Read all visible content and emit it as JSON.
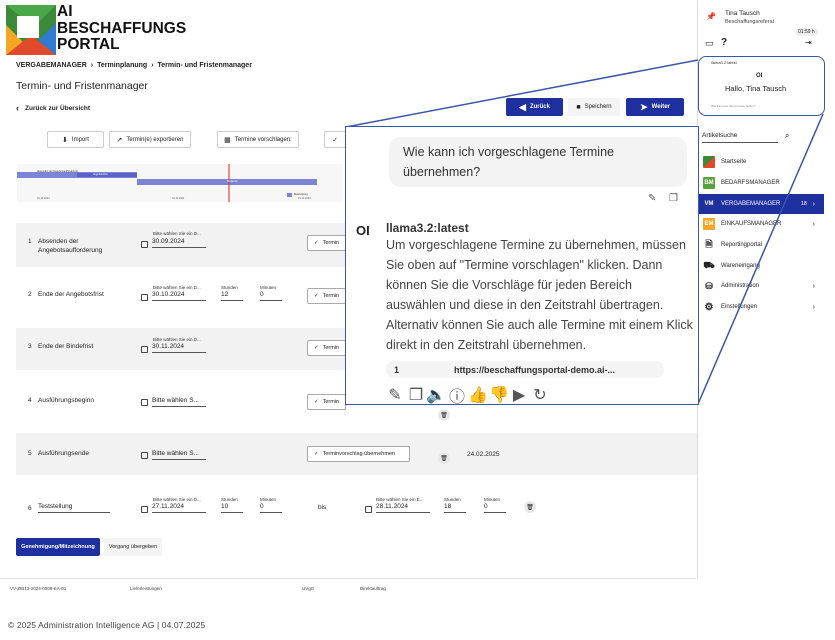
{
  "logo": {
    "line1": "AI",
    "line2": "BESCHAFFUNGS",
    "line3": "PORTAL"
  },
  "breadcrumb": [
    "VERGABEMANAGER",
    "Terminplanung",
    "Termin- und Fristenmanager"
  ],
  "page_title": "Termin- und Fristenmanager",
  "back_link": "Zurück zur Übersicht",
  "actions": {
    "back": "Zurück",
    "save": "Speichern",
    "next": "Weiter"
  },
  "toolbar": {
    "import": "Import",
    "export": "Termin(e) exportieren",
    "suggest": "Termine vorschlagen:"
  },
  "gantt": {
    "bar1": "Absenden der Angebotsaufforderung",
    "bar2": "Angebotsfrist",
    "bar3": "Bindefrist",
    "legend": "Bearbeitung",
    "d1": "01.10.2024",
    "d2": "01.11.2024",
    "d3": "01.12.2024"
  },
  "rows": [
    {
      "num": "1",
      "label": "Absenden der Angebotsaufforderung",
      "hint": "Bitte wählen Sie ein D...",
      "date": "30.09.2024",
      "btn": "Termin"
    },
    {
      "num": "2",
      "label": "Ende der Angebotsfrist",
      "hint": "Bitte wählen Sie ein D...",
      "date": "30.10.2024",
      "hours_label": "Stunden",
      "hours": "12",
      "min_label": "Minuten",
      "min": "0",
      "btn": "Termin"
    },
    {
      "num": "3",
      "label": "Ende der Bindefrist",
      "hint": "Bitte wählen Sie ein D...",
      "date": "30.11.2024",
      "btn": "Termin"
    },
    {
      "num": "4",
      "label": "Ausführungsbeginn",
      "date": "Bitte wählen S...",
      "btn": "Termin"
    },
    {
      "num": "5",
      "label": "Ausführungsende",
      "date": "Bitte wählen S...",
      "btn": "Terminvorschlag übernehmen",
      "suggest_date": "24.02.2025"
    },
    {
      "num": "6",
      "label": "Teststellung",
      "hint": "Bitte wählen Sie ein D...",
      "date": "27.11.2024",
      "hours_label": "Stunden",
      "hours": "10",
      "min_label": "Minuten",
      "min": "0",
      "bis": "bis",
      "hint2": "Bitte wählen Sie ein E...",
      "date2": "28.11.2024",
      "hours2": "18",
      "min2": "0"
    }
  ],
  "bottom": {
    "approval": "Genehmigung/Mitzeichnung",
    "handover": "Vorgang übergeben"
  },
  "footer": {
    "id": "VV-ZIB13-2024-0008-EA-01",
    "type": "Lieferleistungen",
    "law": "UVgO",
    "proc": "Direktauftrag"
  },
  "copyright": "© 2025 Administration Intelligence AG  | 04.07.2025",
  "user": {
    "name": "Tina Tausch",
    "dept": "Beschaffungsreferat",
    "timer": "01:59 h"
  },
  "mini_chat": {
    "model": "llama3.2:latest",
    "logo": "OI",
    "greeting": "Hallo, Tina Tausch",
    "placeholder": "Wie kann ich Ihnen heute helfen?"
  },
  "search_label": "Artikelsuche",
  "nav": [
    {
      "label": "Startseite"
    },
    {
      "label": "BEDARFSMANAGER",
      "badge": "BM"
    },
    {
      "label": "VERGABEMANAGER",
      "badge": "VM",
      "count": "18"
    },
    {
      "label": "EINKAUFSMANAGER",
      "badge": "EM"
    },
    {
      "label": "Reportingportal"
    },
    {
      "label": "Wareneingang"
    },
    {
      "label": "Administration"
    },
    {
      "label": "Einstellungen"
    }
  ],
  "chat": {
    "question": "Wie kann ich vorgeschlagene Termine übernehmen?",
    "model": "llama3.2:latest",
    "avatar": "OI",
    "answer": "Um vorgeschlagene Termine zu übernehmen, müssen Sie oben auf \"Termine vorschlagen\" klicken. Dann können Sie die Vorschläge für jeden Bereich auswählen und diese in den Zeitstrahl übertragen. Alternativ können Sie auch alle Termine mit einem Klick direkt in den Zeitstrahl übernehmen.",
    "source_num": "1",
    "source_url": "https://beschaffungsportal-demo.ai-..."
  },
  "colors": {
    "primary": "#1e2f9e",
    "gantt_bar": "#7c84d6",
    "callout": "#3b56a8"
  }
}
